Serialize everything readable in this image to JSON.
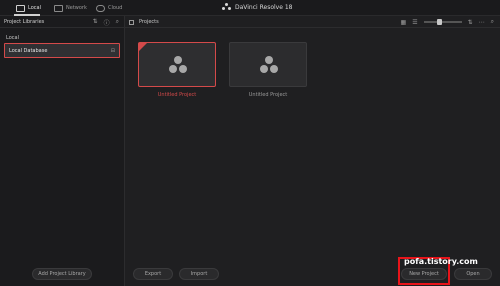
{
  "topbar": {
    "tabs": [
      {
        "label": "Local",
        "icon": "computer-icon"
      },
      {
        "label": "Network",
        "icon": "network-icon"
      },
      {
        "label": "Cloud",
        "icon": "cloud-icon"
      }
    ],
    "title": "DaVinci Resolve 18"
  },
  "left": {
    "title": "Project Libraries",
    "section": "Local",
    "db_item": "Local Database",
    "add_label": "Add Project Library"
  },
  "main": {
    "header_label": "Projects",
    "projects": [
      {
        "name": "Untitled Project",
        "selected": true
      },
      {
        "name": "Untitled Project",
        "selected": false
      }
    ],
    "export_label": "Export",
    "import_label": "Import",
    "new_project_label": "New Project",
    "open_label": "Open"
  },
  "overlay": {
    "watermark": "pofa.tistory.com"
  },
  "colors": {
    "accent_red": "#d44a4a",
    "annotation_red": "#e8141a"
  }
}
